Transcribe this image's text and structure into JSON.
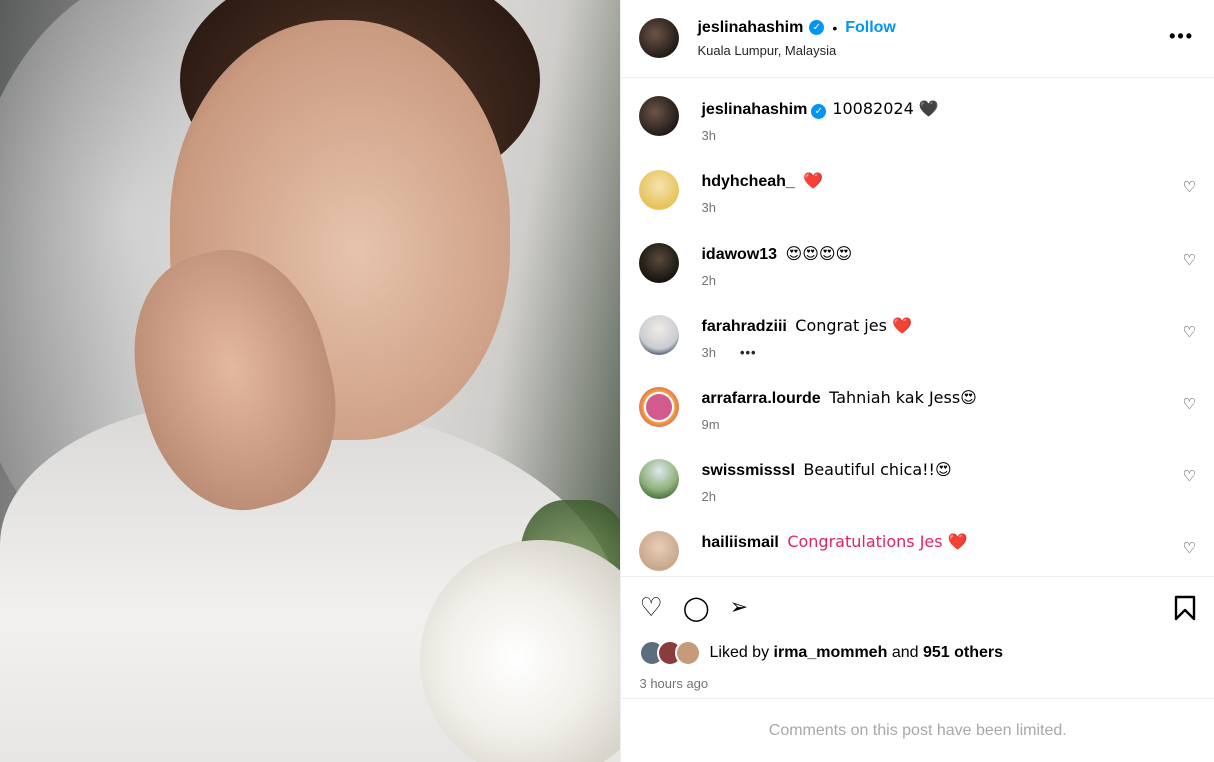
{
  "post": {
    "author": "jeslinahashim",
    "follow_label": "Follow",
    "separator": "•",
    "location": "Kuala Lumpur, Malaysia",
    "more_label": "•••"
  },
  "caption": {
    "user": "jeslinahashim",
    "text": "10082024 🖤",
    "time": "3h"
  },
  "comments": [
    {
      "user": "hdyhcheah_",
      "text": "❤️",
      "time": "3h",
      "avatar_color": "#e8c35a"
    },
    {
      "user": "idawow13",
      "text": "😍😍😍😍",
      "time": "2h",
      "avatar_color": "#2f2a22"
    },
    {
      "user": "farahradziii",
      "text": "Congrat jes ❤️",
      "time": "3h",
      "extra": "•••",
      "avatar_color": "#c9ccd2"
    },
    {
      "user": "arrafarra.lourde",
      "text": "Tahniah kak Jess😍",
      "time": "9m",
      "avatar_color": "#c0427a"
    },
    {
      "user": "swissmisssl",
      "text": "Beautiful chica!!😍",
      "time": "2h",
      "avatar_color": "#4f7a4a"
    },
    {
      "user": "hailiismail",
      "text": "Congratulations Jes ❤️",
      "time": "",
      "avatar_color": "#c8a88c"
    }
  ],
  "likes": {
    "prefix": "Liked by",
    "user": "irma_mommeh",
    "middle": "and",
    "others": "951 others"
  },
  "timestamp": "3 hours ago",
  "limited_notice": "Comments on this post have been limited.",
  "icons": {
    "heart": "♡",
    "comment": "◯",
    "share": "➢",
    "save": "🔖",
    "verified": "✓"
  },
  "colors": {
    "accent": "#0095f6",
    "muted": "#737373",
    "limited": "#a8a8a8"
  }
}
